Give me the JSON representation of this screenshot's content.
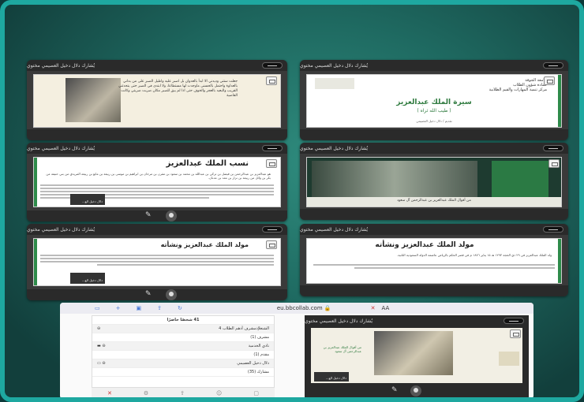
{
  "participant_bar": "يُشارك دلال دخيل العصيمي مختوي",
  "participant_bar_short": "يُشارك دلال دخيل العصيمي مختوي",
  "presenter_label": "دلال دخيل الع...",
  "slides": {
    "s1": {
      "uni_lines": [
        "جامعة الجوفة",
        "عمادة شؤون الطلاب",
        "مركز تنمية المهارات والقيم الطلابية"
      ],
      "title": "سيرة الملك عبدالعزيز",
      "subtitle": "( طيب الله ثراه )",
      "footer": "تقديم / دلال دخيل العصيمي"
    },
    "s2": {
      "quote": "جعلت ستتي وديدني الا ابدأ بالعدوان بل اصبر عليه واطيل الصبر على من بداني بالعداوة واحتمل بالحسنى ماوجدت لها مستطاعا، ولا ابتدى في الصبر حتى يتحدثني القريب والبعيد بالعجز والخوف حتى اذا لم يبق للصبر مكان ضربت ضربتي وكانت القاضية"
    },
    "s3": {
      "title": "نسب الملك عبدالعزيز",
      "body": "هو عبدالعزيز بن عبدالرحمن بن فيصل بن تركي بن عبدالله بن محمد بن سعود بن مقرن بن مرخان بن ابراهيم بن موسى بن ربيعة بن مانع بن ربيعة المريدي من بني حنيفة من بكر بن وائل من ربيعة بن نزار بن معد بن عدنان."
    },
    "s4": {
      "caption": "من أقوال الملك عبدالعزيز بن عبدالرحمن آل سعود"
    },
    "s5": {
      "title": "مولد الملك عبدالعزيز ونشأته"
    },
    "s6": {
      "title": "مولد الملك عبدالعزيز ونشأته",
      "body": "ولد الملك عبدالعزيز في ٢٩ ذي الحجة ١٢٩٣ هـ ١٥ يناير ١٨٧٦ م في قصر الحكم بالرياض عاصمة الدولة السعودية الثانية."
    }
  },
  "phone": {
    "url": "eu.bbcollab.com",
    "zoom": "AA",
    "attendees_title": "41 شخصًا حاضرًا",
    "participants_rows": [
      {
        "label": "الشنغلإدمشرف أدهم الطلاب 4",
        "kind": "header"
      },
      {
        "label": "مشرف (1)",
        "kind": "group"
      },
      {
        "label": "نادي الخدمية",
        "kind": "item"
      },
      {
        "label": "مقدم (1)",
        "kind": "group"
      },
      {
        "label": "دلال دخيل العصيمي",
        "kind": "item"
      },
      {
        "label": "مشارك (35)",
        "kind": "group"
      }
    ],
    "slide_caption": "من أقوال الملك عبدالعزيز بن عبدالرحمن آل سعود"
  },
  "colors": {
    "accent": "#1ea8a0",
    "slide_green": "#2e8b4a",
    "bar_dark": "#2a2a2a"
  }
}
